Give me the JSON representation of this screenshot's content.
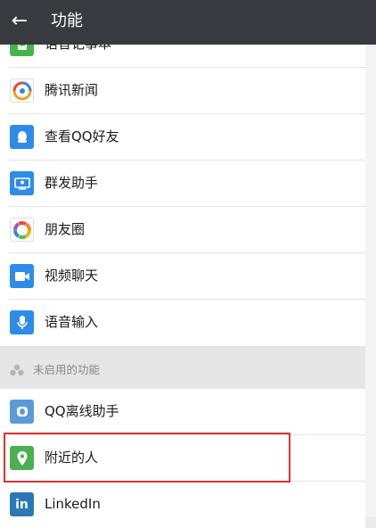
{
  "header": {
    "back_glyph": "←",
    "title": "功能"
  },
  "enabled_items": [
    {
      "label": "语音记事本",
      "icon": "voice-notebook-icon",
      "color": "#44b549"
    },
    {
      "label": "腾讯新闻",
      "icon": "tencent-news-icon",
      "color": "#ffffff"
    },
    {
      "label": "查看QQ好友",
      "icon": "qq-friends-icon",
      "color": "#2d8ce8"
    },
    {
      "label": "群发助手",
      "icon": "mass-send-icon",
      "color": "#2d8ce8"
    },
    {
      "label": "朋友圈",
      "icon": "moments-icon",
      "color": "#ffffff"
    },
    {
      "label": "视频聊天",
      "icon": "video-chat-icon",
      "color": "#2d8ce8"
    },
    {
      "label": "语音输入",
      "icon": "voice-input-icon",
      "color": "#2d8ce8"
    }
  ],
  "disabled_section": {
    "label": "未启用的功能"
  },
  "disabled_items": [
    {
      "label": "QQ离线助手",
      "icon": "qq-offline-assistant-icon",
      "color": "#5b9bd5"
    },
    {
      "label": "附近的人",
      "icon": "people-nearby-icon",
      "color": "#4caf50"
    },
    {
      "label": "LinkedIn",
      "icon": "linkedin-icon",
      "color": "#2a79b6"
    }
  ],
  "highlight_color": "#e03131"
}
